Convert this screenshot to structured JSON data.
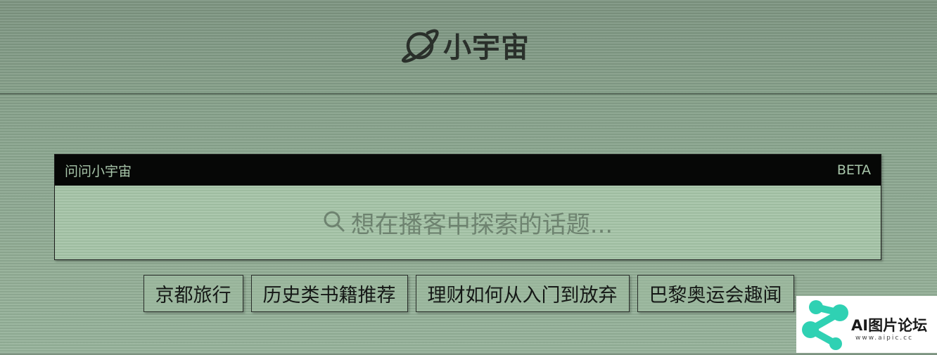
{
  "header": {
    "logo_text": "小宇宙"
  },
  "ask_panel": {
    "title": "问问小宇宙",
    "badge": "BETA",
    "search_placeholder": "想在播客中探索的话题..."
  },
  "suggestions": [
    {
      "label": "京都旅行"
    },
    {
      "label": "历史类书籍推荐"
    },
    {
      "label": "理财如何从入门到放弃"
    },
    {
      "label": "巴黎奥运会趣闻"
    }
  ],
  "watermark": {
    "text": "AI图片论坛",
    "url": "www.aipic.cc"
  },
  "colors": {
    "background": "#86a08a",
    "panel_bar": "#060706",
    "panel_bar_text": "#a8c6aa",
    "search_bg": "#a3c2a5",
    "text_dark": "#2a302b",
    "watermark_accent": "#2fd1b3"
  },
  "icons": {
    "logo": "planet-icon",
    "search": "search-icon"
  }
}
